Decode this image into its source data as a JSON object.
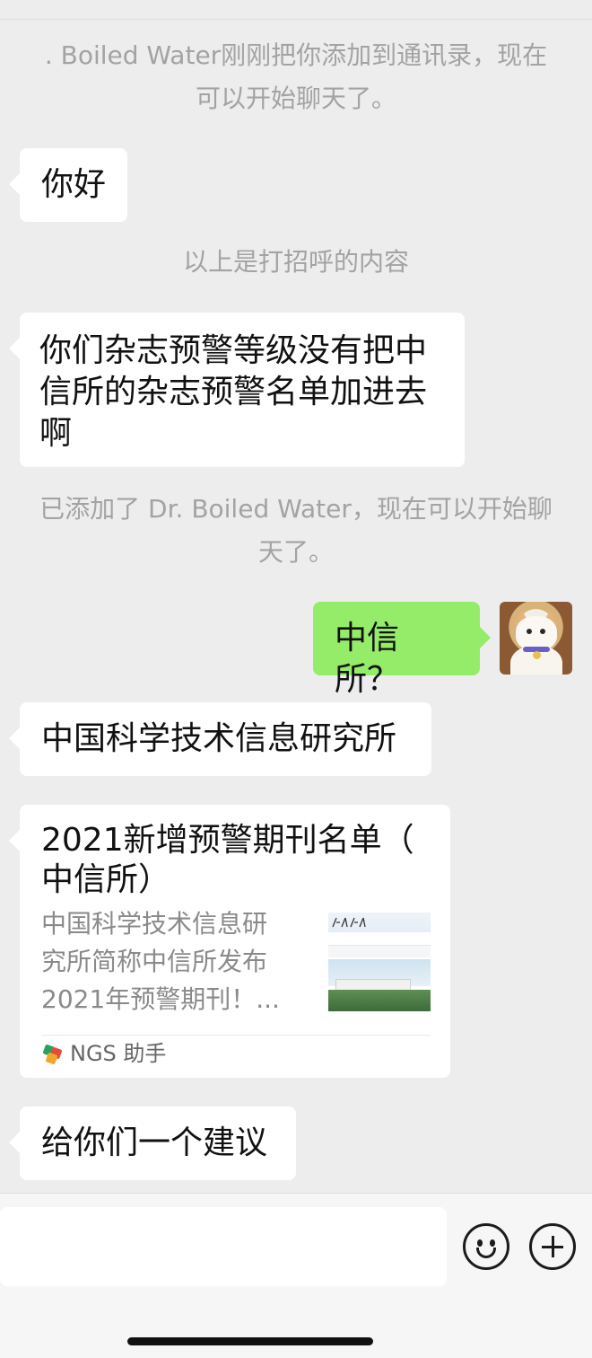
{
  "system_messages": {
    "added_by_contact": ". Boiled Water刚刚把你添加到通讯录，现在\n可以开始聊天了。",
    "greeting_note": "以上是打招呼的内容",
    "added_contact": "已添加了 Dr. Boiled Water，现在可以开始聊\n天了。"
  },
  "messages": {
    "greeting": "你好",
    "question": "你们杂志预警等级没有把中\n信所的杂志预警名单加进去\n啊",
    "reply_self": "中信所？",
    "answer": "中国科学技术信息研究所",
    "suggestion": "给你们一个建议"
  },
  "card": {
    "title": "2021新增预警期刊名单（\n中信所）",
    "description": "中国科学技术信息研\n究所简称中信所发布\n2021年预警期刊！...",
    "source": "NGS 助手",
    "thumbnail_icon": "institute-website-thumbnail"
  },
  "icons": {
    "emoji": "emoji-icon",
    "plus": "plus-icon",
    "avatar": "cat-avatar"
  },
  "colors": {
    "chat_background": "#ededed",
    "outgoing_bubble": "#95ec69",
    "incoming_bubble": "#ffffff",
    "system_text": "#a3a3a3"
  }
}
